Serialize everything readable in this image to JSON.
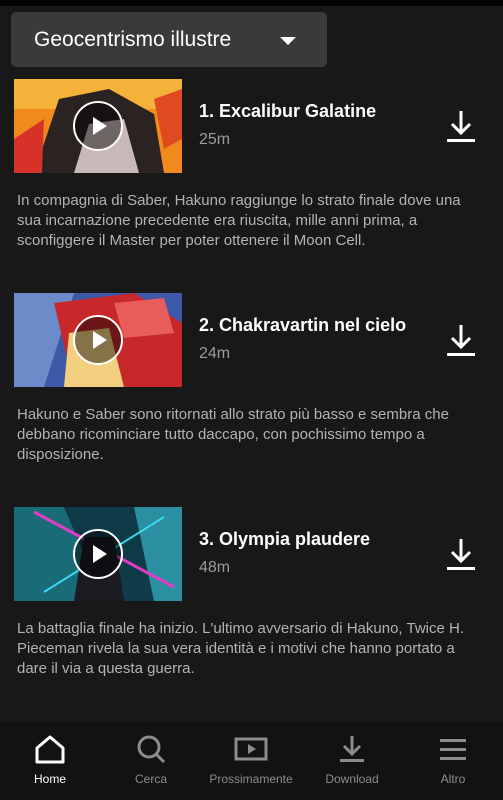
{
  "season_selector": {
    "label": "Geocentrismo illustre"
  },
  "episodes": [
    {
      "title": "1. Excalibur Galatine",
      "duration": "25m",
      "description": "In compagnia di Saber, Hakuno raggiunge lo strato finale dove una sua incarnazione precedente era riuscita, mille anni prima, a sconfiggere il Master per poter ottenere il Moon Cell."
    },
    {
      "title": "2. Chakravartin nel cielo",
      "duration": "24m",
      "description": "Hakuno e Saber sono ritornati allo strato più basso e sembra che debbano ricominciare tutto daccapo, con pochissimo tempo a disposizione."
    },
    {
      "title": "3. Olympia plaudere",
      "duration": "48m",
      "description": "La battaglia finale ha inizio. L'ultimo avversario di Hakuno, Twice H. Pieceman rivela la sua vera identità e i motivi che hanno portato a dare il via a questa guerra."
    }
  ],
  "nav": {
    "home": "Home",
    "search": "Cerca",
    "coming_soon": "Prossimamente",
    "downloads": "Download",
    "more": "Altro"
  },
  "icons": {
    "season_caret": "caret-down-icon",
    "play": "play-icon",
    "download": "download-icon",
    "home": "home-icon",
    "search": "search-icon",
    "coming_soon": "tv-play-icon",
    "downloads": "download-icon",
    "more": "menu-icon"
  },
  "colors": {
    "background": "#181818",
    "nav_bg": "#121212",
    "text_secondary": "#b3b3b3"
  }
}
